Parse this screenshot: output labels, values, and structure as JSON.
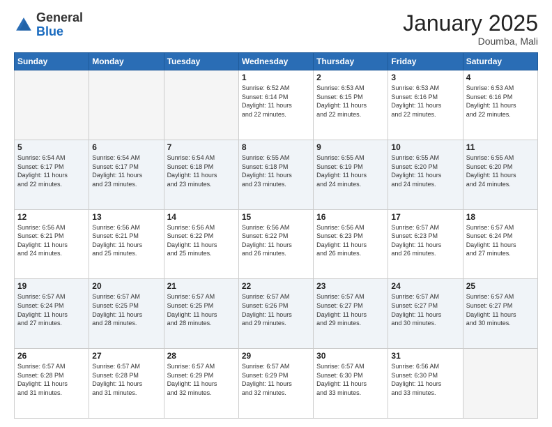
{
  "header": {
    "logo_general": "General",
    "logo_blue": "Blue",
    "month_title": "January 2025",
    "subtitle": "Doumba, Mali"
  },
  "days_of_week": [
    "Sunday",
    "Monday",
    "Tuesday",
    "Wednesday",
    "Thursday",
    "Friday",
    "Saturday"
  ],
  "weeks": [
    [
      {
        "day": "",
        "info": ""
      },
      {
        "day": "",
        "info": ""
      },
      {
        "day": "",
        "info": ""
      },
      {
        "day": "1",
        "info": "Sunrise: 6:52 AM\nSunset: 6:14 PM\nDaylight: 11 hours\nand 22 minutes."
      },
      {
        "day": "2",
        "info": "Sunrise: 6:53 AM\nSunset: 6:15 PM\nDaylight: 11 hours\nand 22 minutes."
      },
      {
        "day": "3",
        "info": "Sunrise: 6:53 AM\nSunset: 6:16 PM\nDaylight: 11 hours\nand 22 minutes."
      },
      {
        "day": "4",
        "info": "Sunrise: 6:53 AM\nSunset: 6:16 PM\nDaylight: 11 hours\nand 22 minutes."
      }
    ],
    [
      {
        "day": "5",
        "info": "Sunrise: 6:54 AM\nSunset: 6:17 PM\nDaylight: 11 hours\nand 22 minutes."
      },
      {
        "day": "6",
        "info": "Sunrise: 6:54 AM\nSunset: 6:17 PM\nDaylight: 11 hours\nand 23 minutes."
      },
      {
        "day": "7",
        "info": "Sunrise: 6:54 AM\nSunset: 6:18 PM\nDaylight: 11 hours\nand 23 minutes."
      },
      {
        "day": "8",
        "info": "Sunrise: 6:55 AM\nSunset: 6:18 PM\nDaylight: 11 hours\nand 23 minutes."
      },
      {
        "day": "9",
        "info": "Sunrise: 6:55 AM\nSunset: 6:19 PM\nDaylight: 11 hours\nand 24 minutes."
      },
      {
        "day": "10",
        "info": "Sunrise: 6:55 AM\nSunset: 6:20 PM\nDaylight: 11 hours\nand 24 minutes."
      },
      {
        "day": "11",
        "info": "Sunrise: 6:55 AM\nSunset: 6:20 PM\nDaylight: 11 hours\nand 24 minutes."
      }
    ],
    [
      {
        "day": "12",
        "info": "Sunrise: 6:56 AM\nSunset: 6:21 PM\nDaylight: 11 hours\nand 24 minutes."
      },
      {
        "day": "13",
        "info": "Sunrise: 6:56 AM\nSunset: 6:21 PM\nDaylight: 11 hours\nand 25 minutes."
      },
      {
        "day": "14",
        "info": "Sunrise: 6:56 AM\nSunset: 6:22 PM\nDaylight: 11 hours\nand 25 minutes."
      },
      {
        "day": "15",
        "info": "Sunrise: 6:56 AM\nSunset: 6:22 PM\nDaylight: 11 hours\nand 26 minutes."
      },
      {
        "day": "16",
        "info": "Sunrise: 6:56 AM\nSunset: 6:23 PM\nDaylight: 11 hours\nand 26 minutes."
      },
      {
        "day": "17",
        "info": "Sunrise: 6:57 AM\nSunset: 6:23 PM\nDaylight: 11 hours\nand 26 minutes."
      },
      {
        "day": "18",
        "info": "Sunrise: 6:57 AM\nSunset: 6:24 PM\nDaylight: 11 hours\nand 27 minutes."
      }
    ],
    [
      {
        "day": "19",
        "info": "Sunrise: 6:57 AM\nSunset: 6:24 PM\nDaylight: 11 hours\nand 27 minutes."
      },
      {
        "day": "20",
        "info": "Sunrise: 6:57 AM\nSunset: 6:25 PM\nDaylight: 11 hours\nand 28 minutes."
      },
      {
        "day": "21",
        "info": "Sunrise: 6:57 AM\nSunset: 6:25 PM\nDaylight: 11 hours\nand 28 minutes."
      },
      {
        "day": "22",
        "info": "Sunrise: 6:57 AM\nSunset: 6:26 PM\nDaylight: 11 hours\nand 29 minutes."
      },
      {
        "day": "23",
        "info": "Sunrise: 6:57 AM\nSunset: 6:27 PM\nDaylight: 11 hours\nand 29 minutes."
      },
      {
        "day": "24",
        "info": "Sunrise: 6:57 AM\nSunset: 6:27 PM\nDaylight: 11 hours\nand 30 minutes."
      },
      {
        "day": "25",
        "info": "Sunrise: 6:57 AM\nSunset: 6:27 PM\nDaylight: 11 hours\nand 30 minutes."
      }
    ],
    [
      {
        "day": "26",
        "info": "Sunrise: 6:57 AM\nSunset: 6:28 PM\nDaylight: 11 hours\nand 31 minutes."
      },
      {
        "day": "27",
        "info": "Sunrise: 6:57 AM\nSunset: 6:28 PM\nDaylight: 11 hours\nand 31 minutes."
      },
      {
        "day": "28",
        "info": "Sunrise: 6:57 AM\nSunset: 6:29 PM\nDaylight: 11 hours\nand 32 minutes."
      },
      {
        "day": "29",
        "info": "Sunrise: 6:57 AM\nSunset: 6:29 PM\nDaylight: 11 hours\nand 32 minutes."
      },
      {
        "day": "30",
        "info": "Sunrise: 6:57 AM\nSunset: 6:30 PM\nDaylight: 11 hours\nand 33 minutes."
      },
      {
        "day": "31",
        "info": "Sunrise: 6:56 AM\nSunset: 6:30 PM\nDaylight: 11 hours\nand 33 minutes."
      },
      {
        "day": "",
        "info": ""
      }
    ]
  ]
}
